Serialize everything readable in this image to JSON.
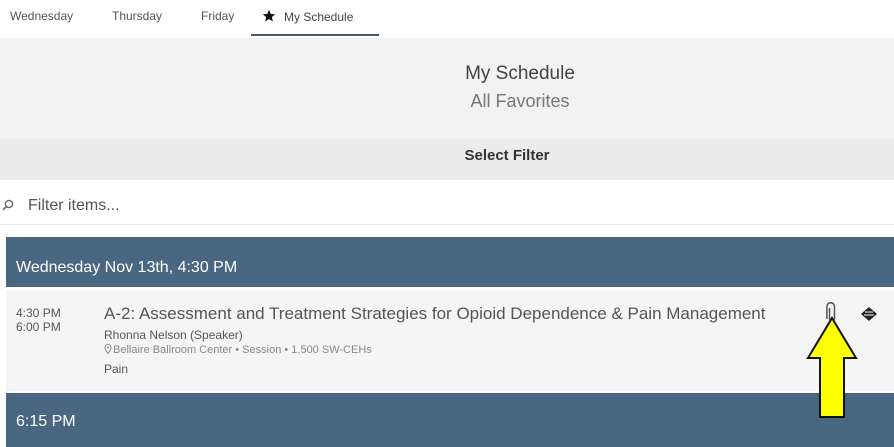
{
  "tabs": {
    "wednesday": "Wednesday",
    "thursday": "Thursday",
    "friday": "Friday",
    "my_schedule": "My Schedule"
  },
  "header": {
    "title": "My Schedule",
    "subtitle": "All Favorites"
  },
  "filter": {
    "label": "Select Filter"
  },
  "search": {
    "placeholder": "Filter items...",
    "value": ""
  },
  "groups": [
    {
      "header": "Wednesday Nov 13th, 4:30 PM",
      "sessions": [
        {
          "start": "4:30 PM",
          "end": "6:00 PM",
          "title": "A-2: Assessment and Treatment Strategies for Opioid Dependence & Pain Management",
          "speaker": "Rhonna Nelson (Speaker)",
          "location": "Bellaire Ballroom Center • Session • 1.500 SW-CEHs",
          "track": "Pain"
        }
      ]
    },
    {
      "header": "6:15 PM"
    }
  ],
  "icons": {
    "tab_star": "star-icon",
    "search": "search-icon",
    "location": "map-pin-icon",
    "attachment": "paperclip-icon",
    "tag": "tag-icon",
    "annotation": "up-arrow-annotation"
  },
  "colors": {
    "group_header_bg": "#4a6782",
    "annotation_arrow": "#ffff00",
    "tab_underline": "#3d5a74"
  }
}
